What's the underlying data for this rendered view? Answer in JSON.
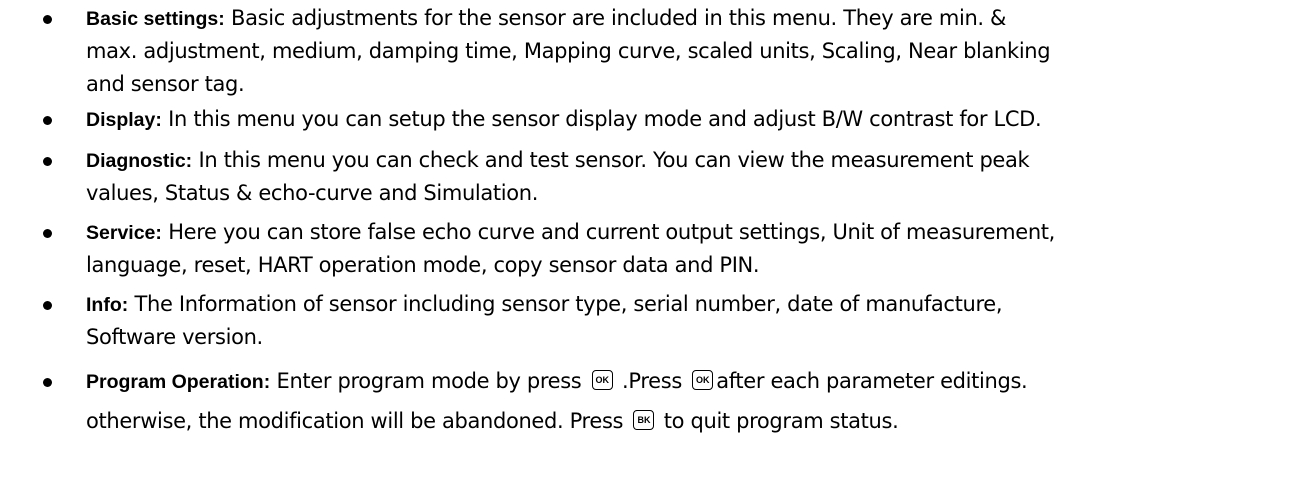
{
  "bullets": [
    {
      "term": "Basic settings:",
      "lines": [
        " Basic adjustments for the sensor are included in this menu. They are min. &",
        "max. adjustment, medium, damping time, Mapping curve, scaled units, Scaling, Near blanking",
        "and sensor tag."
      ]
    },
    {
      "term": "Display:",
      "lines": [
        " In this menu you can setup the sensor display mode and adjust B/W contrast for LCD."
      ]
    },
    {
      "term": "Diagnostic:",
      "lines": [
        " In this menu you can check and test sensor. You can view the measurement peak",
        "values, Status & echo-curve and Simulation."
      ]
    },
    {
      "term": "Service:",
      "lines": [
        " Here you can store false echo curve and current output settings, Unit of measurement,",
        "language, reset, HART operation mode, copy sensor data and PIN."
      ]
    },
    {
      "term": "Info:",
      "lines": [
        " The Information of sensor including sensor type, serial number, date of manufacture,",
        "Software version."
      ]
    },
    {
      "term": "Program Operation:",
      "parts": [
        " Enter program mode by press ",
        " .Press ",
        "after each parameter editings."
      ],
      "line2_parts": [
        "otherwise, the modification will be abandoned. Press ",
        " to quit program status."
      ],
      "keys": [
        "OK",
        "OK",
        "BK"
      ]
    }
  ]
}
